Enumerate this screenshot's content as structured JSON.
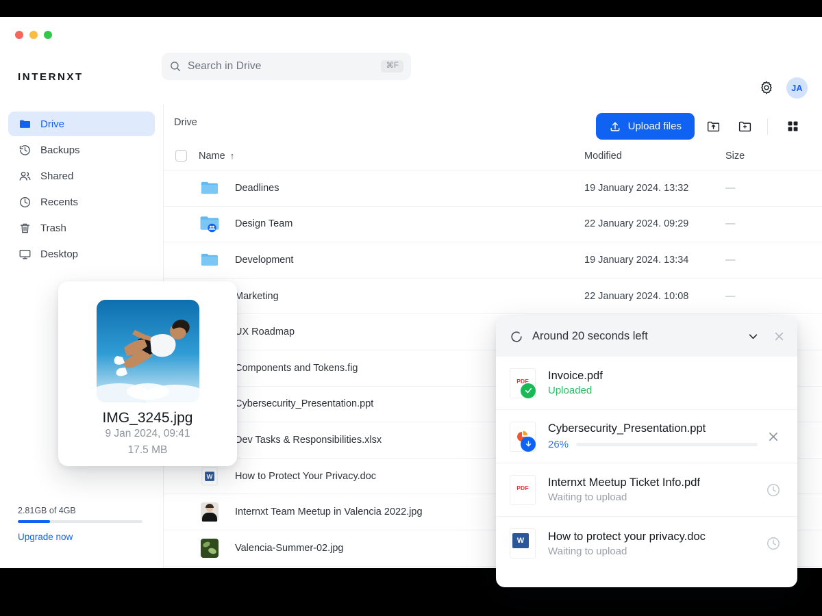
{
  "window": {
    "traffic_lights": [
      "close",
      "minimize",
      "maximize"
    ]
  },
  "header": {
    "brand": "INTERNXT",
    "search": {
      "placeholder": "Search in Drive",
      "shortcut": "⌘F"
    },
    "gear_label": "Settings",
    "avatar_initials": "JA"
  },
  "sidebar": {
    "items": [
      {
        "label": "Drive",
        "icon": "folder-icon",
        "active": true
      },
      {
        "label": "Backups",
        "icon": "history-icon",
        "active": false
      },
      {
        "label": "Shared",
        "icon": "people-icon",
        "active": false
      },
      {
        "label": "Recents",
        "icon": "clock-icon",
        "active": false
      },
      {
        "label": "Trash",
        "icon": "trash-icon",
        "active": false
      },
      {
        "label": "Desktop",
        "icon": "monitor-icon",
        "active": false
      }
    ],
    "storage": {
      "label": "2.81GB of 4GB",
      "used_percent": 26,
      "upgrade_label": "Upgrade now"
    }
  },
  "main": {
    "breadcrumb": "Drive",
    "toolbar": {
      "upload_label": "Upload files",
      "upload_folder_label": "Upload folder",
      "new_folder_label": "New folder",
      "grid_view_label": "Grid view",
      "accent_color": "#0f62f2"
    },
    "table": {
      "columns": {
        "name": "Name",
        "sort_arrow": "↑",
        "modified": "Modified",
        "size": "Size"
      },
      "rows": [
        {
          "name": "Deadlines",
          "icon": "folder-icon",
          "modified": "19 January 2024. 13:32",
          "size": "—"
        },
        {
          "name": "Design Team",
          "icon": "shared-folder-icon",
          "modified": "22 January 2024. 09:29",
          "size": "—"
        },
        {
          "name": "Development",
          "icon": "folder-icon",
          "modified": "19 January 2024. 13:34",
          "size": "—"
        },
        {
          "name": "Marketing",
          "icon": "folder-icon",
          "modified": "22 January 2024. 10:08",
          "size": "—"
        },
        {
          "name": "UX Roadmap",
          "icon": "folder-icon",
          "modified": "",
          "size": ""
        },
        {
          "name": "Components and Tokens.fig",
          "icon": "figma-file-icon",
          "modified": "",
          "size": ""
        },
        {
          "name": "Cybersecurity_Presentation.ppt",
          "icon": "powerpoint-file-icon",
          "modified": "",
          "size": ""
        },
        {
          "name": "Dev Tasks & Responsibilities.xlsx",
          "icon": "excel-file-icon",
          "modified": "",
          "size": ""
        },
        {
          "name": "How to Protect Your Privacy.doc",
          "icon": "word-file-icon",
          "modified": "",
          "size": ""
        },
        {
          "name": "Internxt Team Meetup in Valencia 2022.jpg",
          "icon": "image-thumbnail-person",
          "modified": "",
          "size": ""
        },
        {
          "name": "Valencia-Summer-02.jpg",
          "icon": "image-thumbnail-leaf",
          "modified": "",
          "size": ""
        }
      ]
    }
  },
  "preview_card": {
    "filename": "IMG_3245.jpg",
    "date": "9 Jan 2024, 09:41",
    "size": "17.5 MB",
    "thumbnail": "photo-person-jumping-sky"
  },
  "upload_panel": {
    "title": "Around 20 seconds left",
    "spinner_icon": "loading-spinner-icon",
    "collapse_label": "Collapse",
    "close_label": "Close",
    "items": [
      {
        "name": "Invoice.pdf",
        "status": "Uploaded",
        "state": "done",
        "icon": "pdf-file-icon",
        "percent": null,
        "action": "none"
      },
      {
        "name": "Cybersecurity_Presentation.ppt",
        "status": "26%",
        "state": "uploading",
        "icon": "powerpoint-file-icon",
        "percent": 26,
        "action": "cancel"
      },
      {
        "name": "Internxt Meetup Ticket Info.pdf",
        "status": "Waiting to upload",
        "state": "waiting",
        "icon": "pdf-file-icon",
        "percent": null,
        "action": "pending"
      },
      {
        "name": "How to protect your privacy.doc",
        "status": "Waiting to upload",
        "state": "waiting",
        "icon": "word-file-icon",
        "percent": null,
        "action": "pending"
      }
    ]
  }
}
